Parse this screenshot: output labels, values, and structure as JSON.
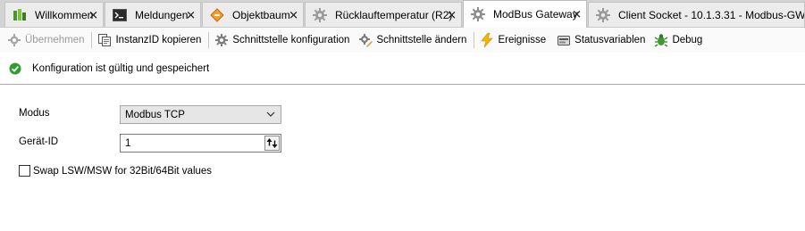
{
  "tabs": [
    {
      "label": "Willkommen",
      "icon": "welcome-icon",
      "closable": true,
      "active": false
    },
    {
      "label": "Meldungen",
      "icon": "console-icon",
      "closable": true,
      "active": false
    },
    {
      "label": "Objektbaum",
      "icon": "object-tree-icon",
      "closable": true,
      "active": false
    },
    {
      "label": "Rücklauftemperatur (R2)",
      "icon": "gear-icon",
      "closable": true,
      "active": false
    },
    {
      "label": "ModBus Gateway",
      "icon": "gear-icon",
      "closable": true,
      "active": true
    },
    {
      "label": "Client Socket - 10.1.3.31 - Modbus-GW",
      "icon": "gear-icon",
      "closable": false,
      "active": false
    }
  ],
  "toolbar": {
    "apply": "Übernehmen",
    "copy_instance_id": "InstanzID kopieren",
    "interface_config": "Schnittstelle konfiguration",
    "interface_change": "Schnittstelle ändern",
    "events": "Ereignisse",
    "status_variables": "Statusvariablen",
    "debug": "Debug"
  },
  "status": {
    "message": "Konfiguration ist gültig und gespeichert",
    "color": "#2e9e2e"
  },
  "form": {
    "mode_label": "Modus",
    "mode_value": "Modbus TCP",
    "device_id_label": "Gerät-ID",
    "device_id_value": "1",
    "swap_label": "Swap LSW/MSW for 32Bit/64Bit values",
    "swap_checked": false
  },
  "colors": {
    "tabbar": "#d3d3d3",
    "active_tab": "#ffffff",
    "ok_green": "#2e9e2e",
    "warning_orange": "#e8902a"
  }
}
